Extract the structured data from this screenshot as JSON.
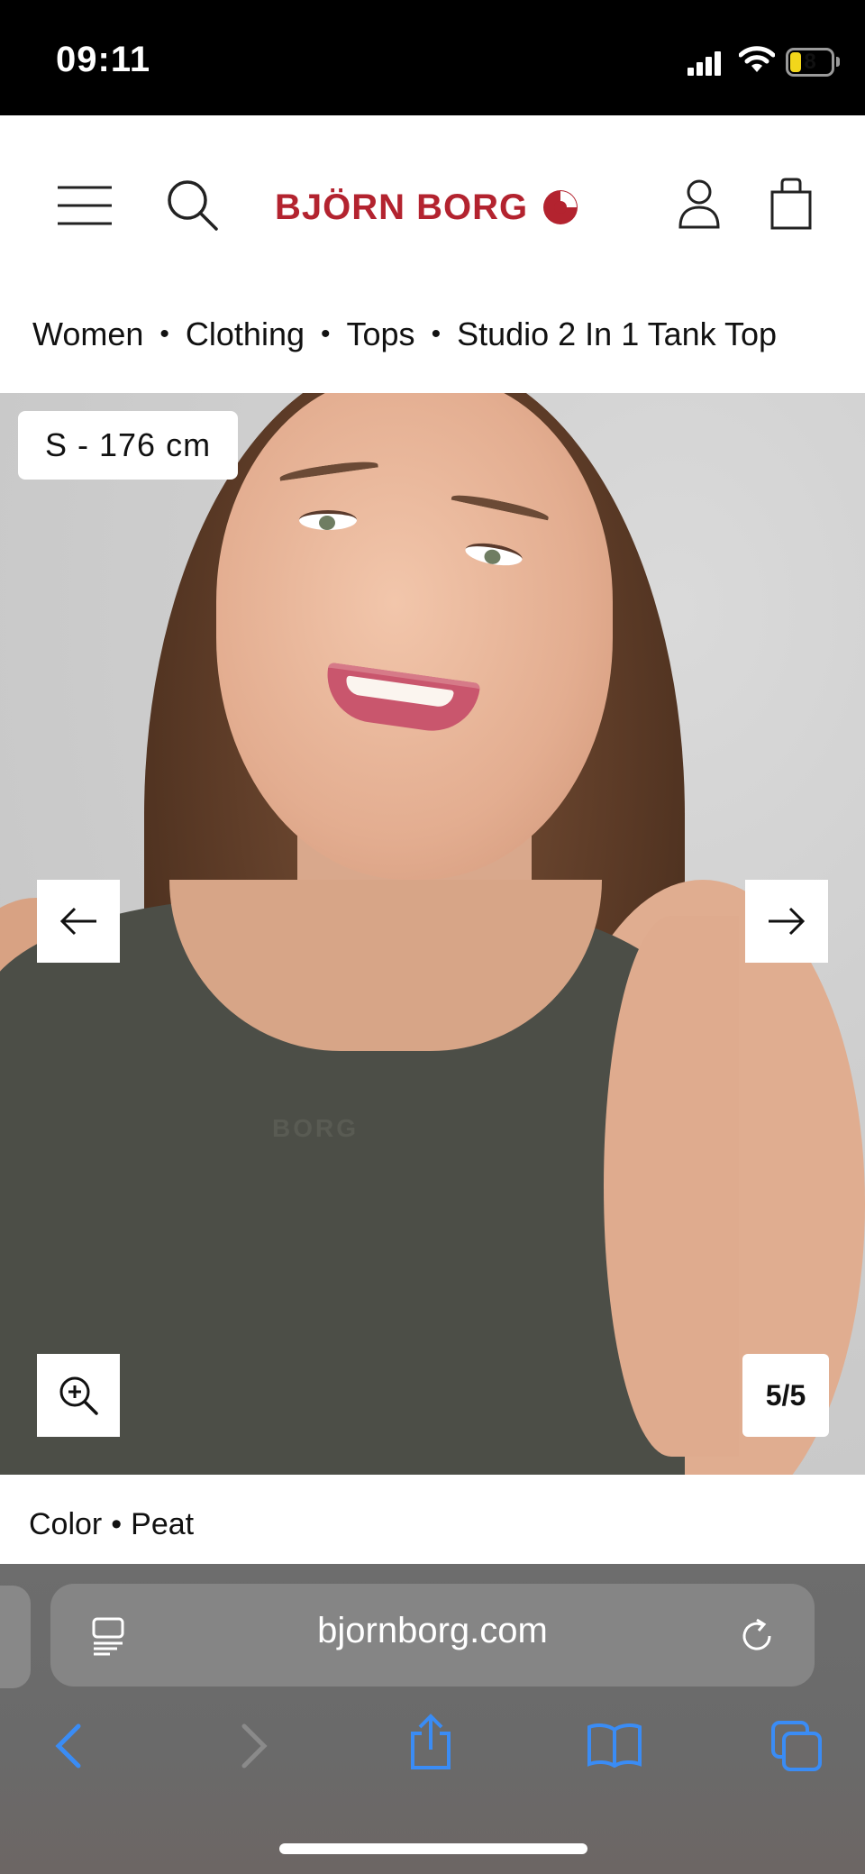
{
  "status_bar": {
    "time": "09:11",
    "battery": "8",
    "battery_color": "#f2d61b"
  },
  "header": {
    "brand": "BJÖRN BORG",
    "brand_color": "#b3232f",
    "icons": [
      "menu-icon",
      "search-icon",
      "account-icon",
      "bag-icon"
    ]
  },
  "breadcrumb": {
    "items": [
      "Women",
      "Clothing",
      "Tops",
      "Studio 2 In 1 Tank Top"
    ],
    "separator": "•"
  },
  "gallery": {
    "size_label": "S - 176 cm",
    "counter": "5/5",
    "garment_logo": "BORG",
    "current_slide": 5,
    "total_slides": 5,
    "icons": [
      "arrow-left-icon",
      "arrow-right-icon",
      "zoom-in-icon"
    ]
  },
  "product": {
    "color_label": "Color",
    "color_separator": "•",
    "color_value": "Peat"
  },
  "browser": {
    "url": "bjornborg.com",
    "accent": "#3a8cf5",
    "icons": [
      "reader-icon",
      "reload-icon",
      "back-icon",
      "forward-icon",
      "share-icon",
      "bookmarks-icon",
      "tabs-icon"
    ]
  }
}
